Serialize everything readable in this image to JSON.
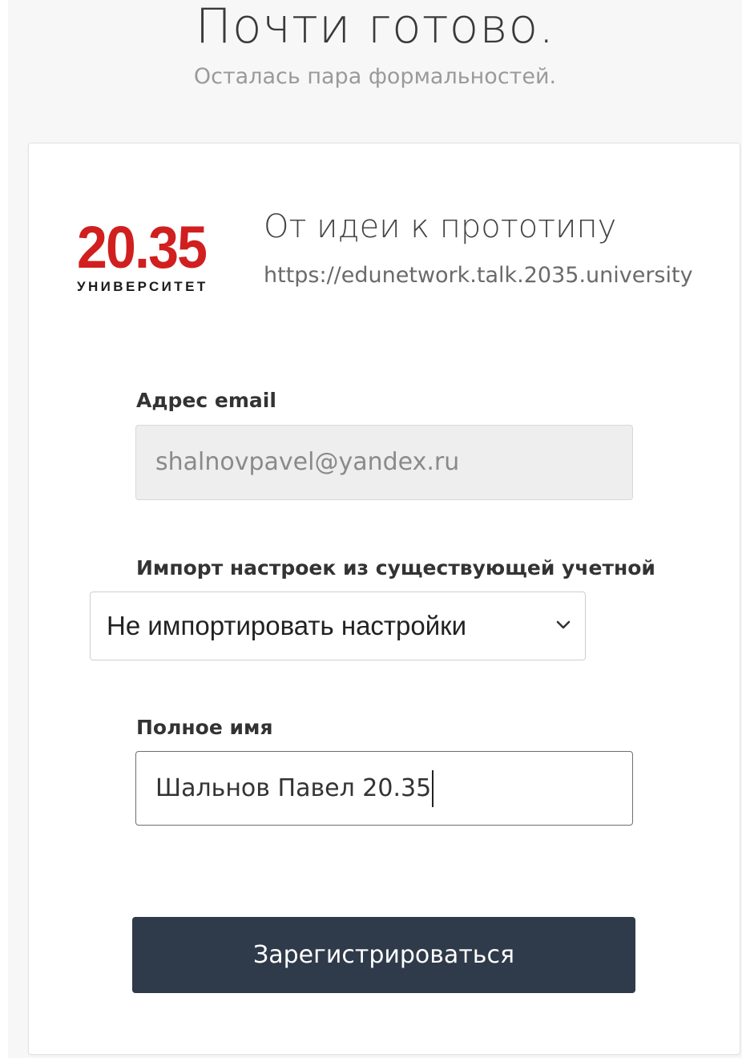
{
  "header": {
    "title": "Почти готово.",
    "subtitle": "Осталась пара формальностей."
  },
  "logo": {
    "number": "20.35",
    "word": "УНИВЕРСИТЕТ"
  },
  "course": {
    "title": "От идеи к прототипу",
    "url": "https://edunetwork.talk.2035.university"
  },
  "form": {
    "email_label": "Адрес email",
    "email_value": "shalnovpavel@yandex.ru",
    "import_label": "Импорт настроек из существующей учетной",
    "import_selected": "Не импортировать настройки",
    "name_label": "Полное имя",
    "name_value": "Шальнов Павел 20.35",
    "submit_label": "Зарегистрироваться"
  },
  "colors": {
    "logo_red": "#d11f1f",
    "button_bg": "#2f3a4a"
  }
}
